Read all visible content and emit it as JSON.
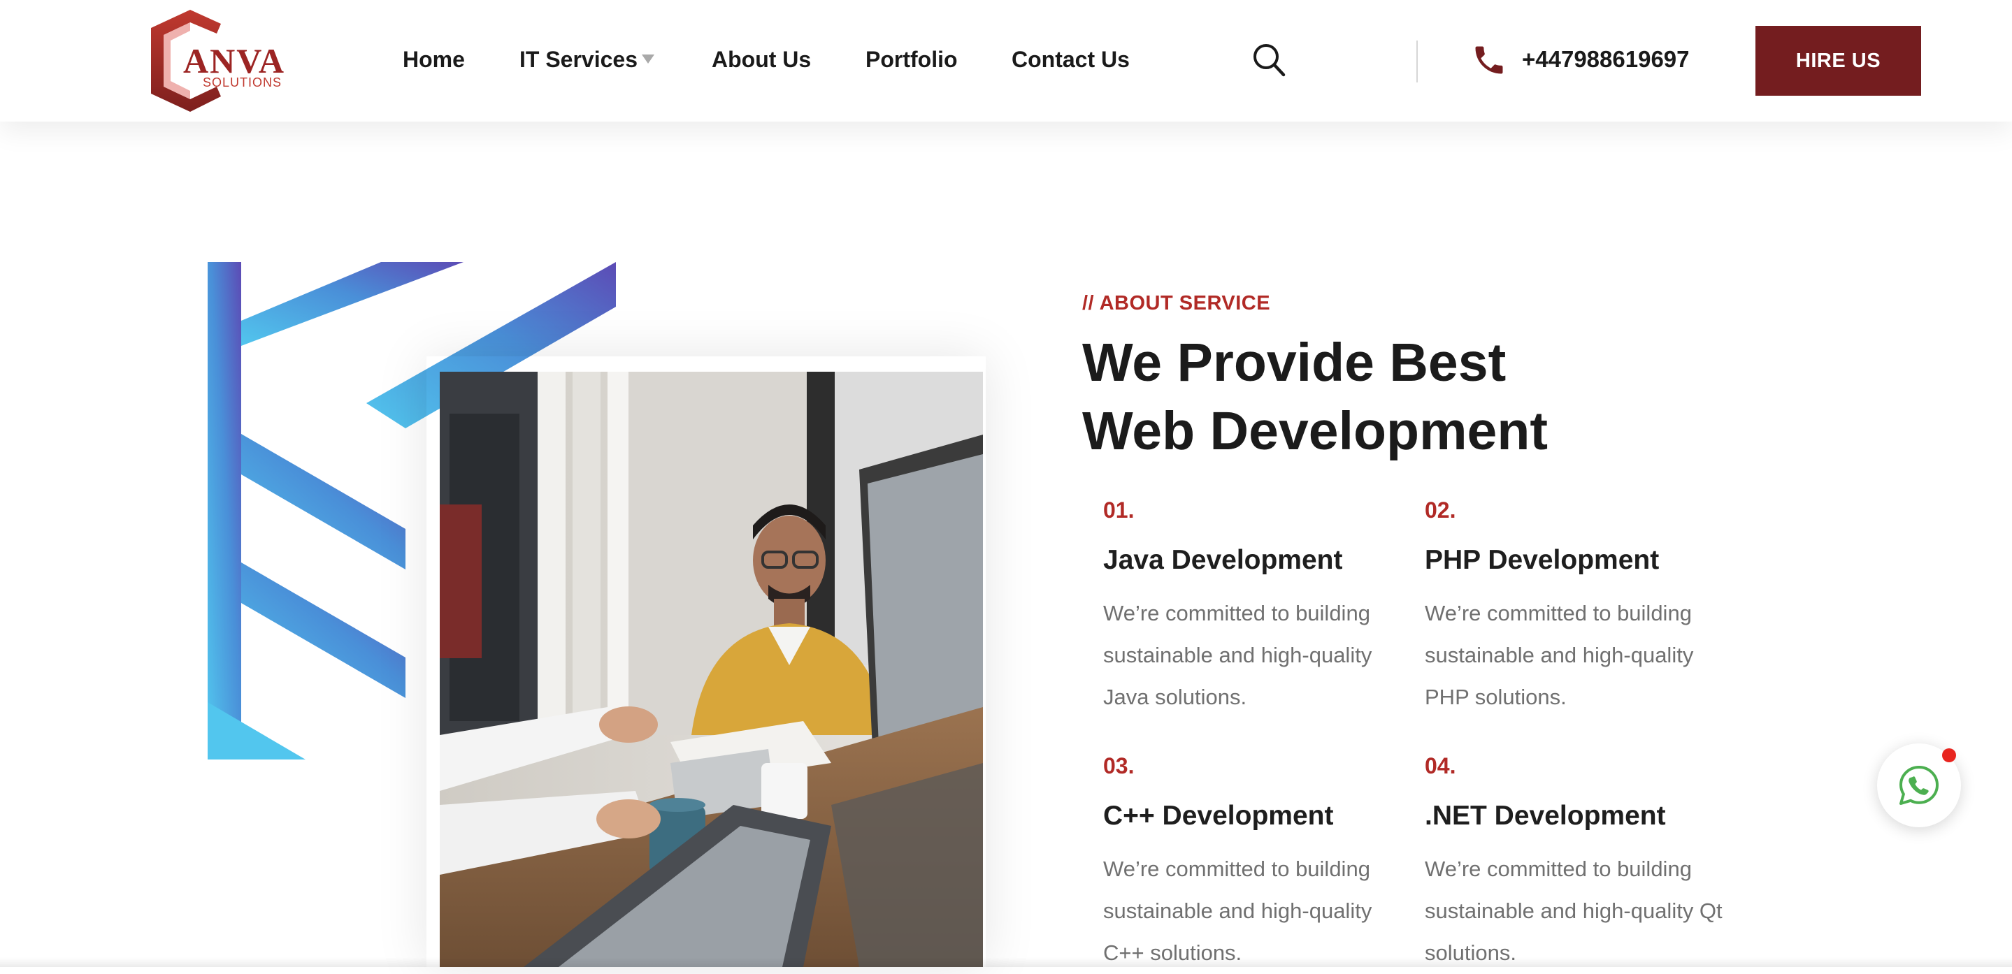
{
  "brand": {
    "logo_main": "ANVA",
    "logo_sub": "SOLUTIONS",
    "primary_color": "#741d1f",
    "accent_color": "#b12a26"
  },
  "nav": {
    "items": [
      {
        "label": "Home"
      },
      {
        "label": "IT Services"
      },
      {
        "label": "About Us"
      },
      {
        "label": "Portfolio"
      },
      {
        "label": "Contact Us"
      }
    ]
  },
  "header": {
    "search_icon": "search-icon",
    "phone_icon": "phone-icon",
    "phone": "+447988619697",
    "hire_label": "HIRE US"
  },
  "about": {
    "eyebrow": "// ABOUT SERVICE",
    "heading_line1": "We Provide Best",
    "heading_line2": "Web Development"
  },
  "services": [
    {
      "num": "01.",
      "title": "Java Development",
      "desc": "We’re committed to building sustainable and high-quality Java solutions."
    },
    {
      "num": "02.",
      "title": "PHP Development",
      "desc": "We’re committed to building sustainable and high-quality PHP solutions."
    },
    {
      "num": "03.",
      "title": "C++ Development",
      "desc": "We’re committed to building sustainable and high-quality C++ solutions."
    },
    {
      "num": "04.",
      "title": ".NET Development",
      "desc": "We’re committed to building sustainable and high-quality Qt solutions."
    }
  ],
  "whatsapp": {
    "icon": "whatsapp-icon",
    "color": "#4caf50",
    "badge_color": "#e8251f"
  }
}
